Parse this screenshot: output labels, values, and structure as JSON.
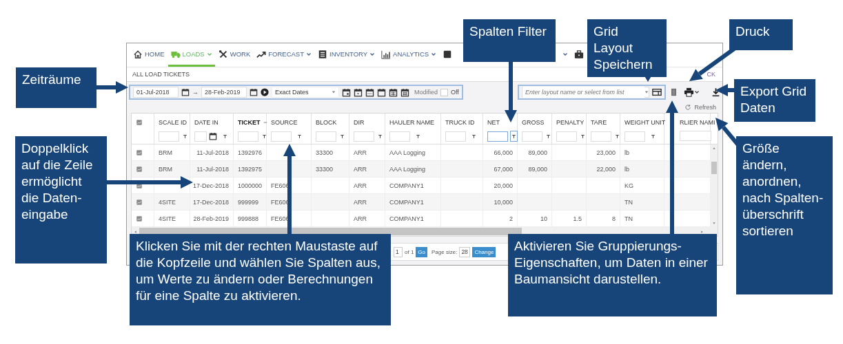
{
  "nav": [
    {
      "label": "HOME",
      "selected": false,
      "dropdown": false
    },
    {
      "label": "LOADS",
      "selected": true,
      "dropdown": true
    },
    {
      "label": "WORK",
      "selected": false,
      "dropdown": false
    },
    {
      "label": "FORECAST",
      "selected": false,
      "dropdown": true
    },
    {
      "label": "INVENTORY",
      "selected": false,
      "dropdown": true
    },
    {
      "label": "ANALYTICS",
      "selected": false,
      "dropdown": true
    },
    {
      "selected": false,
      "dropdown": false
    },
    {
      "selected": false,
      "dropdown": true
    },
    {
      "selected": false,
      "dropdown": false
    }
  ],
  "breadcrumb": "ALL LOAD TICKETS",
  "back_link": "CK",
  "date_range": {
    "from": "01-Jul-2018",
    "arrow": "→",
    "to": "28-Feb-2019",
    "mode": "Exact Dates"
  },
  "modified": {
    "label": "Modified",
    "checked": false,
    "state": "Off"
  },
  "layout": {
    "placeholder": "Enter layout name or select from list"
  },
  "refresh": "Refresh",
  "table": {
    "columns": [
      {
        "label": "SCALE ID",
        "kind": "text",
        "sorted": false,
        "focused": false
      },
      {
        "label": "DATE IN",
        "kind": "date",
        "sorted": false,
        "focused": false
      },
      {
        "label": "TICKET",
        "kind": "text",
        "sorted": true,
        "focused": false
      },
      {
        "label": "SOURCE",
        "kind": "text",
        "sorted": false,
        "focused": false
      },
      {
        "label": "BLOCK",
        "kind": "text",
        "sorted": false,
        "focused": false
      },
      {
        "label": "DIR",
        "kind": "text",
        "sorted": false,
        "focused": false
      },
      {
        "label": "HAULER NAME",
        "kind": "text",
        "sorted": false,
        "focused": false
      },
      {
        "label": "TRUCK ID",
        "kind": "text",
        "sorted": false,
        "focused": false
      },
      {
        "label": "NET",
        "kind": "number",
        "sorted": false,
        "focused": true
      },
      {
        "label": "GROSS",
        "kind": "number",
        "sorted": false,
        "focused": false
      },
      {
        "label": "PENALTY",
        "kind": "number",
        "sorted": false,
        "focused": false
      },
      {
        "label": "TARE",
        "kind": "number",
        "sorted": false,
        "focused": false
      },
      {
        "label": "WEIGHT UNIT",
        "kind": "text",
        "sorted": false,
        "focused": false
      },
      {
        "label": "RLIER NAMI",
        "kind": "partial",
        "sorted": false,
        "focused": false
      }
    ],
    "rows": [
      [
        "BRM",
        "11-Jul-2018",
        "1392976",
        null,
        "33300",
        "ARR",
        "AAA Logging",
        null,
        "66,000",
        "89,000",
        null,
        "23,000",
        "lb",
        null
      ],
      [
        "BRM",
        "11-Jul-2018",
        "1392975",
        null,
        "33300",
        "ARR",
        "AAA Logging",
        null,
        "67,000",
        "89,000",
        null,
        "22,000",
        "lb",
        null
      ],
      [
        null,
        "17-Dec-2018",
        "1000000",
        "FE606",
        null,
        "ARR",
        "COMPANY1",
        null,
        "20,000",
        null,
        null,
        null,
        "KG",
        null
      ],
      [
        "4SITE",
        "17-Dec-2018",
        "999999",
        "FE606",
        null,
        "ARR",
        "COMPANY1",
        null,
        "10,000",
        null,
        null,
        null,
        "TN",
        null
      ],
      [
        "4SITE",
        "28-Feb-2019",
        "999888",
        "FE606",
        null,
        "ARR",
        "COMPANY1",
        null,
        "2",
        "10",
        "1.5",
        "8",
        "TN",
        null
      ]
    ]
  },
  "pager": {
    "page": "1",
    "of": "of 1",
    "go": "Go",
    "size_label": "Page size:",
    "size": "28",
    "change": "Change"
  },
  "callouts": [
    {
      "text": "Zeiträume"
    },
    {
      "text": "Spalten Filter"
    },
    {
      "text": "Grid Layout Speichern"
    },
    {
      "text": "Druck"
    },
    {
      "text": "Export Grid Daten"
    },
    {
      "text": "Doppelklick auf die Zeile ermöglicht die Daten-eingabe"
    },
    {
      "text": "Klicken Sie mit der rechten Maustaste auf die Kopfzeile und wählen Sie Spalten aus, um Werte zu ändern oder Berechnungen für eine Spalte zu aktivieren."
    },
    {
      "text": "Aktivieren Sie Gruppierungs-Eigenschaften, um Daten in einer Baumansicht darustellen."
    },
    {
      "text": "Größe ändern, anordnen, nach Spalten-überschrift sortieren"
    }
  ]
}
